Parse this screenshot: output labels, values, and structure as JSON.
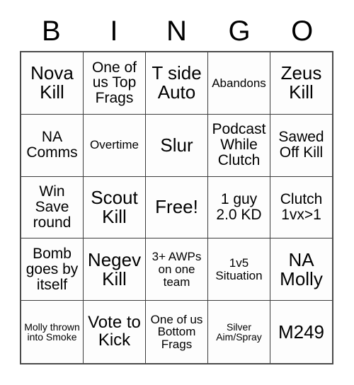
{
  "card": {
    "title": "BINGO",
    "header_letters": [
      "B",
      "I",
      "N",
      "G",
      "O"
    ],
    "free_space_label": "Free!",
    "colors": {
      "page_background": "#ffffff",
      "cell_background": "#fdfdfd",
      "grid_line": "#3c3c3c",
      "grid_border": "#4a4a4a",
      "text": "#000000"
    },
    "grid": {
      "columns": 5,
      "rows": 5,
      "cells": [
        [
          {
            "text": "Nova Kill",
            "size": "xl"
          },
          {
            "text": "One of us Top Frags",
            "size": "md"
          },
          {
            "text": "T side Auto",
            "size": "xl"
          },
          {
            "text": "Abandons",
            "size": "sm"
          },
          {
            "text": "Zeus Kill",
            "size": "xl"
          }
        ],
        [
          {
            "text": "NA Comms",
            "size": "md"
          },
          {
            "text": "Overtime",
            "size": "sm"
          },
          {
            "text": "Slur",
            "size": "xl"
          },
          {
            "text": "Podcast While Clutch",
            "size": "md"
          },
          {
            "text": "Sawed Off Kill",
            "size": "md"
          }
        ],
        [
          {
            "text": "Win Save round",
            "size": "md"
          },
          {
            "text": "Scout Kill",
            "size": "xl"
          },
          {
            "text": "Free!",
            "size": "xl"
          },
          {
            "text": "1 guy 2.0 KD",
            "size": "md"
          },
          {
            "text": "Clutch 1vx>1",
            "size": "md"
          }
        ],
        [
          {
            "text": "Bomb goes by itself",
            "size": "md"
          },
          {
            "text": "Negev Kill",
            "size": "xl"
          },
          {
            "text": "3+ AWPs on one team",
            "size": "sm"
          },
          {
            "text": "1v5 Situation",
            "size": "sm"
          },
          {
            "text": "NA Molly",
            "size": "xl"
          }
        ],
        [
          {
            "text": "Molly thrown into Smoke",
            "size": "xs"
          },
          {
            "text": "Vote to Kick",
            "size": "lg"
          },
          {
            "text": "One of us Bottom Frags",
            "size": "sm"
          },
          {
            "text": "Silver Aim/Spray",
            "size": "xs"
          },
          {
            "text": "M249",
            "size": "xl"
          }
        ]
      ]
    }
  }
}
